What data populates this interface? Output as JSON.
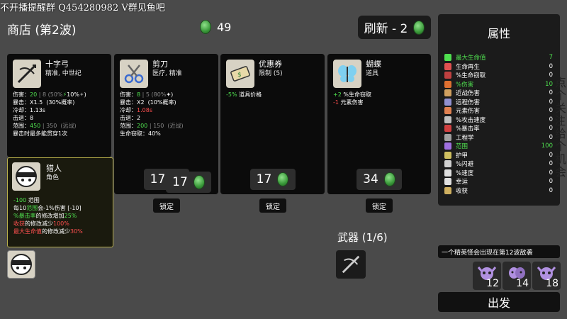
{
  "overlay": {
    "stream_text": "不开播提醒群  Q454280982 V群见鱼吧"
  },
  "header": {
    "shop_title": "商店 (第2波)",
    "materials": "49",
    "refresh_label": "刷新 - 2"
  },
  "shop": [
    {
      "name": "十字弓",
      "sub": "精准, 中世纪",
      "stats": [
        [
          [
            "伤害：",
            "w"
          ],
          [
            "20",
            "g"
          ],
          [
            " | 8 (50%",
            "dim"
          ],
          [
            "⚡",
            "g"
          ],
          [
            "10%",
            "w"
          ],
          [
            "✦",
            "dim"
          ],
          [
            ")",
            "w"
          ]
        ],
        [
          [
            "暴击：X1.5  (30%概率)",
            "w"
          ]
        ],
        [
          [
            "冷却：1.13s",
            "w"
          ]
        ],
        [
          [
            "击退：8",
            "w"
          ]
        ],
        [
          [
            "范围：",
            "w"
          ],
          [
            "450",
            "g"
          ],
          [
            " | 350  (远战)",
            "dim"
          ]
        ],
        [
          [
            "暴击时最多能贯穿1次",
            "w"
          ]
        ]
      ],
      "price": "17",
      "lock": "锁定",
      "icon": "crossbow-icon"
    },
    {
      "name": "剪刀",
      "sub": "医疗, 精准",
      "stats": [
        [
          [
            "伤害：",
            "w"
          ],
          [
            "8",
            "g"
          ],
          [
            " | 5 (80%",
            "dim"
          ],
          [
            "✦",
            "w"
          ],
          [
            ")",
            "w"
          ]
        ],
        [
          [
            "暴击：X2  (10%概率)",
            "w"
          ]
        ],
        [
          [
            "冷却：",
            "w"
          ],
          [
            "1.08s",
            "r"
          ]
        ],
        [
          [
            "击退：2",
            "w"
          ]
        ],
        [
          [
            "范围：",
            "w"
          ],
          [
            "200",
            "g"
          ],
          [
            " | 150  (近战)",
            "dim"
          ]
        ],
        [
          [
            "生命窃取：40%",
            "w"
          ]
        ]
      ],
      "price": "17",
      "lock": "锁定",
      "icon": "scissors-icon"
    },
    {
      "name": "优惠券",
      "sub": "限制 (5)",
      "stats": [
        [
          [
            "-5%",
            "g"
          ],
          [
            " 道具价格",
            "w"
          ]
        ]
      ],
      "price": "17",
      "lock": "锁定",
      "icon": "coupon-icon"
    },
    {
      "name": "蝴蝶",
      "sub": "道具",
      "stats": [
        [
          [
            "+2",
            "g"
          ],
          [
            " %生命窃取",
            "w"
          ]
        ],
        [
          [
            "-1",
            "r"
          ],
          [
            " 元素伤害",
            "w"
          ]
        ]
      ],
      "price": "34",
      "lock": "锁定",
      "icon": "butterfly-icon"
    }
  ],
  "character": {
    "name": "猎人",
    "sub": "角色",
    "lines": [
      [
        [
          "-100",
          "g"
        ],
        [
          " 范围",
          "w"
        ]
      ],
      [
        [
          "每10",
          "w"
        ],
        [
          "范围",
          "g"
        ],
        [
          "会-1%伤害 [-10]",
          "w"
        ]
      ],
      [
        [
          "%暴击率",
          "g"
        ],
        [
          "的修改增加",
          "w"
        ],
        [
          "25%",
          "g"
        ]
      ],
      [
        [
          "收获",
          "r"
        ],
        [
          "的修改减少",
          "w"
        ],
        [
          "100%",
          "r"
        ]
      ],
      [
        [
          "最大生命值",
          "r"
        ],
        [
          "的修改减少",
          "w"
        ],
        [
          "30%",
          "r"
        ]
      ]
    ]
  },
  "weapons": {
    "title": "武器 (1/6)"
  },
  "attributes": {
    "title": "属性",
    "items": [
      {
        "name": "最大生命值",
        "value": "7",
        "green": true,
        "color": "#4fe04f",
        "icon": "heart-icon"
      },
      {
        "name": "生命再生",
        "value": "0",
        "green": false,
        "color": "#e05050",
        "icon": "regen-icon"
      },
      {
        "name": "%生命窃取",
        "value": "0",
        "green": false,
        "color": "#c04040",
        "icon": "lifesteal-icon"
      },
      {
        "name": "%伤害",
        "value": "10",
        "green": true,
        "color": "#e07030",
        "icon": "damage-icon"
      },
      {
        "name": "近战伤害",
        "value": "0",
        "green": false,
        "color": "#d0a060",
        "icon": "melee-icon"
      },
      {
        "name": "远程伤害",
        "value": "0",
        "green": false,
        "color": "#9090d0",
        "icon": "ranged-icon"
      },
      {
        "name": "元素伤害",
        "value": "0",
        "green": false,
        "color": "#e08050",
        "icon": "element-icon"
      },
      {
        "name": "%攻击速度",
        "value": "0",
        "green": false,
        "color": "#c0c0c0",
        "icon": "atkspeed-icon"
      },
      {
        "name": "%暴击率",
        "value": "0",
        "green": false,
        "color": "#d04040",
        "icon": "crit-icon"
      },
      {
        "name": "工程学",
        "value": "0",
        "green": false,
        "color": "#a0a0a0",
        "icon": "engineering-icon"
      },
      {
        "name": "范围",
        "value": "100",
        "green": true,
        "color": "#a070e0",
        "icon": "range-icon"
      },
      {
        "name": "护甲",
        "value": "0",
        "green": false,
        "color": "#d0c060",
        "icon": "armor-icon"
      },
      {
        "name": "%闪避",
        "value": "0",
        "green": false,
        "color": "#d0d0d0",
        "icon": "dodge-icon"
      },
      {
        "name": "%速度",
        "value": "0",
        "green": false,
        "color": "#e0e0e0",
        "icon": "speed-icon"
      },
      {
        "name": "幸运",
        "value": "0",
        "green": false,
        "color": "#e0e0e0",
        "icon": "luck-icon"
      },
      {
        "name": "收获",
        "value": "0",
        "green": false,
        "color": "#d0b060",
        "icon": "harvest-icon"
      }
    ]
  },
  "side_text": "点个关注，给个机会",
  "elite_notice": "一个精英怪会出现在第12波敌袭",
  "dangers": [
    "12",
    "14",
    "18"
  ],
  "go_label": "出发"
}
